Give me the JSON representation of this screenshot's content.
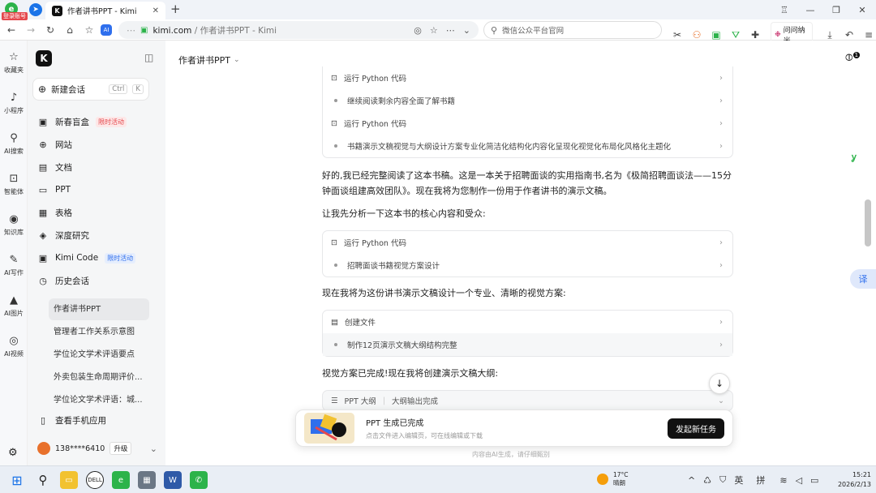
{
  "browser": {
    "tab_title": "作者讲书PPT - Kimi",
    "new_tab": "+",
    "login_badge": "登录账号",
    "url_domain": "kimi.com",
    "url_path": " / 作者讲书PPT - Kimi",
    "search_placeholder": "微信公众平台官网",
    "ext_label": "问问纳米",
    "ai_label": "AI"
  },
  "strip": [
    {
      "icon": "star-icon",
      "glyph": "☆",
      "label": "收藏夹"
    },
    {
      "icon": "mini-program-icon",
      "glyph": "♪",
      "label": "小程序"
    },
    {
      "icon": "search-icon",
      "glyph": "⚲",
      "label": "AI搜索"
    },
    {
      "icon": "agent-icon",
      "glyph": "⊡",
      "label": "智能体"
    },
    {
      "icon": "knowledge-icon",
      "glyph": "◉",
      "label": "知识库"
    },
    {
      "icon": "pen-icon",
      "glyph": "✎",
      "label": "AI写作"
    },
    {
      "icon": "image-icon",
      "glyph": "▲",
      "label": "AI图片"
    },
    {
      "icon": "video-icon",
      "glyph": "◎",
      "label": "AI视频"
    }
  ],
  "sidebar": {
    "logo": "K",
    "new_chat": "新建会话",
    "shortcut_ctrl": "Ctrl",
    "shortcut_k": "K",
    "items": [
      {
        "label": "新春盲盒",
        "badge": "限时活动"
      },
      {
        "label": "网站"
      },
      {
        "label": "文档"
      },
      {
        "label": "PPT"
      },
      {
        "label": "表格"
      },
      {
        "label": "深度研究"
      },
      {
        "label": "Kimi Code",
        "badge": "限时活动"
      },
      {
        "label": "历史会话"
      }
    ],
    "history": [
      "作者讲书PPT",
      "管理者工作关系示意图",
      "学位论文学术评语要点",
      "外卖包装生命周期评价...",
      "学位论文学术评语：城..."
    ],
    "mobile": "查看手机应用",
    "user": "138****6410",
    "upgrade": "升级"
  },
  "main": {
    "title": "作者讲书PPT",
    "attach_count": "1",
    "card1": [
      "运行 Python 代码",
      "继续阅读剩余内容全面了解书籍",
      "运行 Python 代码",
      "书籍演示文稿视觉与大纲设计方案专业化简洁化结构化内容化呈现化视觉化布局化风格化主题化"
    ],
    "para1": "好的,我已经完整阅读了这本书稿。这是一本关于招聘面谈的实用指南书,名为《极简招聘面谈法——15分钟面谈组建高效团队》。现在我将为您制作一份用于作者讲书的演示文稿。",
    "para2": "让我先分析一下这本书的核心内容和受众:",
    "card2": [
      "运行 Python 代码",
      "招聘面谈书籍视觉方案设计"
    ],
    "para3": "现在我将为这份讲书演示文稿设计一个专业、清晰的视觉方案:",
    "card3": [
      "创建文件",
      "制作12页演示文稿大纲结构完整"
    ],
    "para4": "视觉方案已完成!现在我将创建演示文稿大纲:",
    "outline_label": "PPT 大纲",
    "outline_status": "大纲输出完成",
    "toast_title": "PPT 生成已完成",
    "toast_sub": "点击文件进入编辑页，可在线编辑或下载",
    "toast_btn": "发起新任务",
    "footer": "内容由AI生成，请仔细甄别",
    "translate": "译"
  },
  "taskbar": {
    "temp": "17°C",
    "weather": "晴朗",
    "ime1": "英",
    "ime2": "拼",
    "time": "15:21",
    "date": "2026/2/13"
  },
  "colors": {
    "accent": "#1a73e8",
    "badge_red": "#e5484d",
    "badge_blue": "#2f6fed"
  }
}
